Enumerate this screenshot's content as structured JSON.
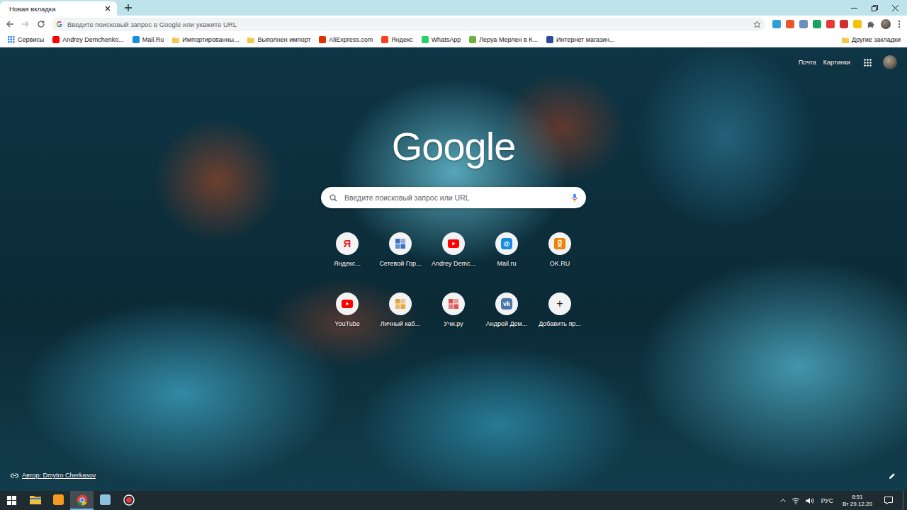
{
  "tabs": [
    {
      "label": "Новая вкладка",
      "selected": true
    }
  ],
  "omnibox": {
    "placeholder": "Введите поисковый запрос в Google или укажите URL"
  },
  "extensions": [
    {
      "color": "#2f9fd8"
    },
    {
      "color": "#e8572a"
    },
    {
      "color": "#6a8fbf"
    },
    {
      "color": "#1aa260"
    },
    {
      "color": "#e53935"
    },
    {
      "color": "#d32f2f"
    },
    {
      "color": "#f4c20d"
    }
  ],
  "bookmarks": [
    {
      "label": "Сервисы",
      "kind": "grid",
      "color": "#4285f4"
    },
    {
      "label": "Andrey Demchenko...",
      "kind": "favicon",
      "color": "#ff0000"
    },
    {
      "label": "Mail.Ru",
      "kind": "favicon",
      "color": "#168de2"
    },
    {
      "label": "Импортированны...",
      "kind": "folder",
      "color": "#f2c94c"
    },
    {
      "label": "Выполнен импорт",
      "kind": "folder",
      "color": "#f2c94c"
    },
    {
      "label": "AliExpress.com",
      "kind": "favicon",
      "color": "#e62e04"
    },
    {
      "label": "Яндекс",
      "kind": "favicon",
      "color": "#fc3f1d"
    },
    {
      "label": "WhatsApp",
      "kind": "favicon",
      "color": "#25d366"
    },
    {
      "label": "Леруа Мерлен в К...",
      "kind": "favicon",
      "color": "#6bb33f"
    },
    {
      "label": "Интернет магазин...",
      "kind": "favicon",
      "color": "#2b4c9b"
    }
  ],
  "other_bookmarks": {
    "label": "Другие закладки",
    "color": "#f2c94c"
  },
  "ntp": {
    "links": [
      "Почта",
      "Картинки"
    ],
    "logo": "Google",
    "search": {
      "placeholder": "Введите поисковый запрос или URL"
    },
    "shortcuts": [
      {
        "label": "Яндекс...",
        "kind": "letter",
        "glyph": "Я",
        "color": "#e52620"
      },
      {
        "label": "Сетевой Гор...",
        "kind": "tiles",
        "glyph": "",
        "color": "#3b6fc4"
      },
      {
        "label": "Andrey Demc...",
        "kind": "play",
        "glyph": "",
        "color": "#ff0000"
      },
      {
        "label": "Mail.ru",
        "kind": "badge",
        "glyph": "@",
        "color": "#168de2"
      },
      {
        "label": "OK.RU",
        "kind": "ok",
        "glyph": "",
        "color": "#ee8208"
      },
      {
        "label": "YouTube",
        "kind": "play",
        "glyph": "",
        "color": "#ff0000"
      },
      {
        "label": "Личный каб...",
        "kind": "tiles",
        "glyph": "",
        "color": "#e8a33a"
      },
      {
        "label": "Учи.ру",
        "kind": "tiles",
        "glyph": "",
        "color": "#d9534f"
      },
      {
        "label": "Андрей Дем...",
        "kind": "badge",
        "glyph": "vk",
        "color": "#4a76a8"
      },
      {
        "label": "Добавить яр...",
        "kind": "add",
        "glyph": "+",
        "color": "#202124"
      }
    ],
    "attribution": "Автор: Dmytro Cherkasov"
  },
  "taskbar": {
    "apps": [
      {
        "kind": "folder",
        "color": "#f0c040",
        "selected": false
      },
      {
        "kind": "square",
        "color": "#f59a23",
        "selected": false
      },
      {
        "kind": "chrome",
        "color": "#4285f4",
        "selected": true
      },
      {
        "kind": "square",
        "color": "#8cc4e0",
        "selected": false
      },
      {
        "kind": "record",
        "color": "#e53935",
        "selected": false
      }
    ],
    "language": "РУС",
    "time": "8:51",
    "date": "Вт 29.12.20"
  }
}
